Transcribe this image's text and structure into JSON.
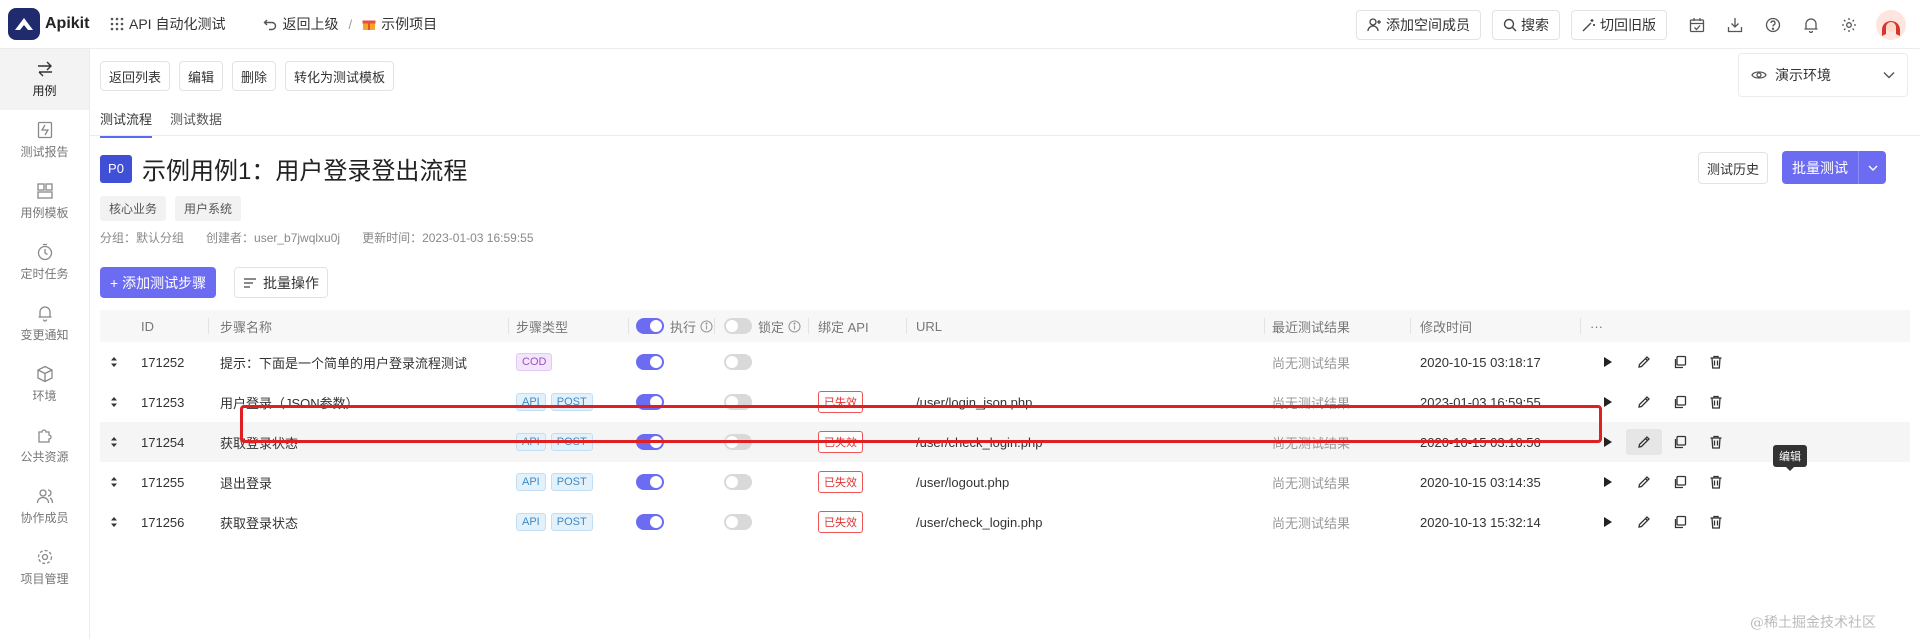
{
  "header": {
    "brand": "Apikit",
    "app_name": "API 自动化测试",
    "back_label": "返回上级",
    "separator": "/",
    "project_name": "示例项目",
    "add_member_label": "添加空间成员",
    "search_label": "搜索",
    "old_version_label": "切回旧版"
  },
  "sidebar": {
    "items": [
      {
        "label": "用例",
        "icon": "swap-arrows-icon"
      },
      {
        "label": "测试报告",
        "icon": "report-icon"
      },
      {
        "label": "用例模板",
        "icon": "template-icon"
      },
      {
        "label": "定时任务",
        "icon": "timer-icon"
      },
      {
        "label": "变更通知",
        "icon": "bell-icon"
      },
      {
        "label": "环境",
        "icon": "cube-icon"
      },
      {
        "label": "公共资源",
        "icon": "puzzle-icon"
      },
      {
        "label": "协作成员",
        "icon": "users-icon"
      },
      {
        "label": "项目管理",
        "icon": "gear-icon"
      }
    ]
  },
  "toolbar": {
    "back_to_list": "返回列表",
    "edit": "编辑",
    "delete": "删除",
    "convert_template": "转化为测试模板"
  },
  "env": {
    "label": "演示环境"
  },
  "tabs": [
    {
      "label": "测试流程",
      "active": true
    },
    {
      "label": "测试数据",
      "active": false
    }
  ],
  "case": {
    "priority": "P0",
    "title": "示例用例1：用户登录登出流程",
    "tags": [
      "核心业务",
      "用户系统"
    ],
    "group": "分组：默认分组",
    "creator": "创建者：user_b7jwqlxu0j",
    "updated": "更新时间：2023-01-03 16:59:55"
  },
  "actions": {
    "history": "测试历史",
    "batch_test": "批量测试",
    "add_step": "+ 添加测试步骤",
    "batch_op": "批量操作"
  },
  "table": {
    "headers": {
      "id": "ID",
      "name": "步骤名称",
      "type": "步骤类型",
      "exec": "执行",
      "lock": "锁定",
      "bind_api": "绑定 API",
      "url": "URL",
      "result": "最近测试结果",
      "modified": "修改时间",
      "more": "···"
    },
    "rows": [
      {
        "id": "171252",
        "name": "提示：下面是一个简单的用户登录流程测试",
        "type1": "COD",
        "type2": "",
        "exec": true,
        "lock": false,
        "bind": "",
        "url": "",
        "result": "尚无测试结果",
        "modified": "2020-10-15 03:18:17"
      },
      {
        "id": "171253",
        "name": "用户登录（JSON参数）",
        "type1": "API",
        "type2": "POST",
        "exec": true,
        "lock": false,
        "bind": "已失效",
        "url": "/user/login_json.php",
        "result": "尚无测试结果",
        "modified": "2023-01-03 16:59:55"
      },
      {
        "id": "171254",
        "name": "获取登录状态",
        "type1": "API",
        "type2": "POST",
        "exec": true,
        "lock": false,
        "bind": "已失效",
        "url": "/user/check_login.php",
        "result": "尚无测试结果",
        "modified": "2020-10-15 03:16:56"
      },
      {
        "id": "171255",
        "name": "退出登录",
        "type1": "API",
        "type2": "POST",
        "exec": true,
        "lock": false,
        "bind": "已失效",
        "url": "/user/logout.php",
        "result": "尚无测试结果",
        "modified": "2020-10-15 03:14:35"
      },
      {
        "id": "171256",
        "name": "获取登录状态",
        "type1": "API",
        "type2": "POST",
        "exec": true,
        "lock": false,
        "bind": "已失效",
        "url": "/user/check_login.php",
        "result": "尚无测试结果",
        "modified": "2020-10-13 15:32:14"
      }
    ]
  },
  "tooltip": "编辑",
  "watermark": "@稀土掘金技术社区",
  "colors": {
    "accent": "#6c6cf2",
    "highlight": "#e02020",
    "invalid": "#d33333"
  }
}
